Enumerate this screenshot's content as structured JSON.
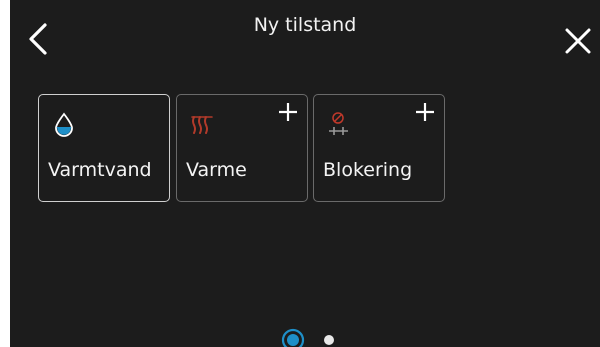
{
  "header": {
    "title": "Ny tilstand",
    "back_icon": "chevron-left-icon",
    "close_icon": "close-icon"
  },
  "tiles": [
    {
      "label": "Varmtvand",
      "icon": "water-drop-icon",
      "selected": true,
      "has_add": false
    },
    {
      "label": "Varme",
      "icon": "heat-waves-icon",
      "selected": false,
      "has_add": true
    },
    {
      "label": "Blokering",
      "icon": "blocking-icon",
      "selected": false,
      "has_add": true
    }
  ],
  "pager": {
    "pages": 2,
    "current_page": 1
  },
  "colors": {
    "background": "#1c1c1c",
    "accent_blue": "#1e8fc8",
    "heat_red": "#b23a2a",
    "block_red": "#c0392b"
  }
}
